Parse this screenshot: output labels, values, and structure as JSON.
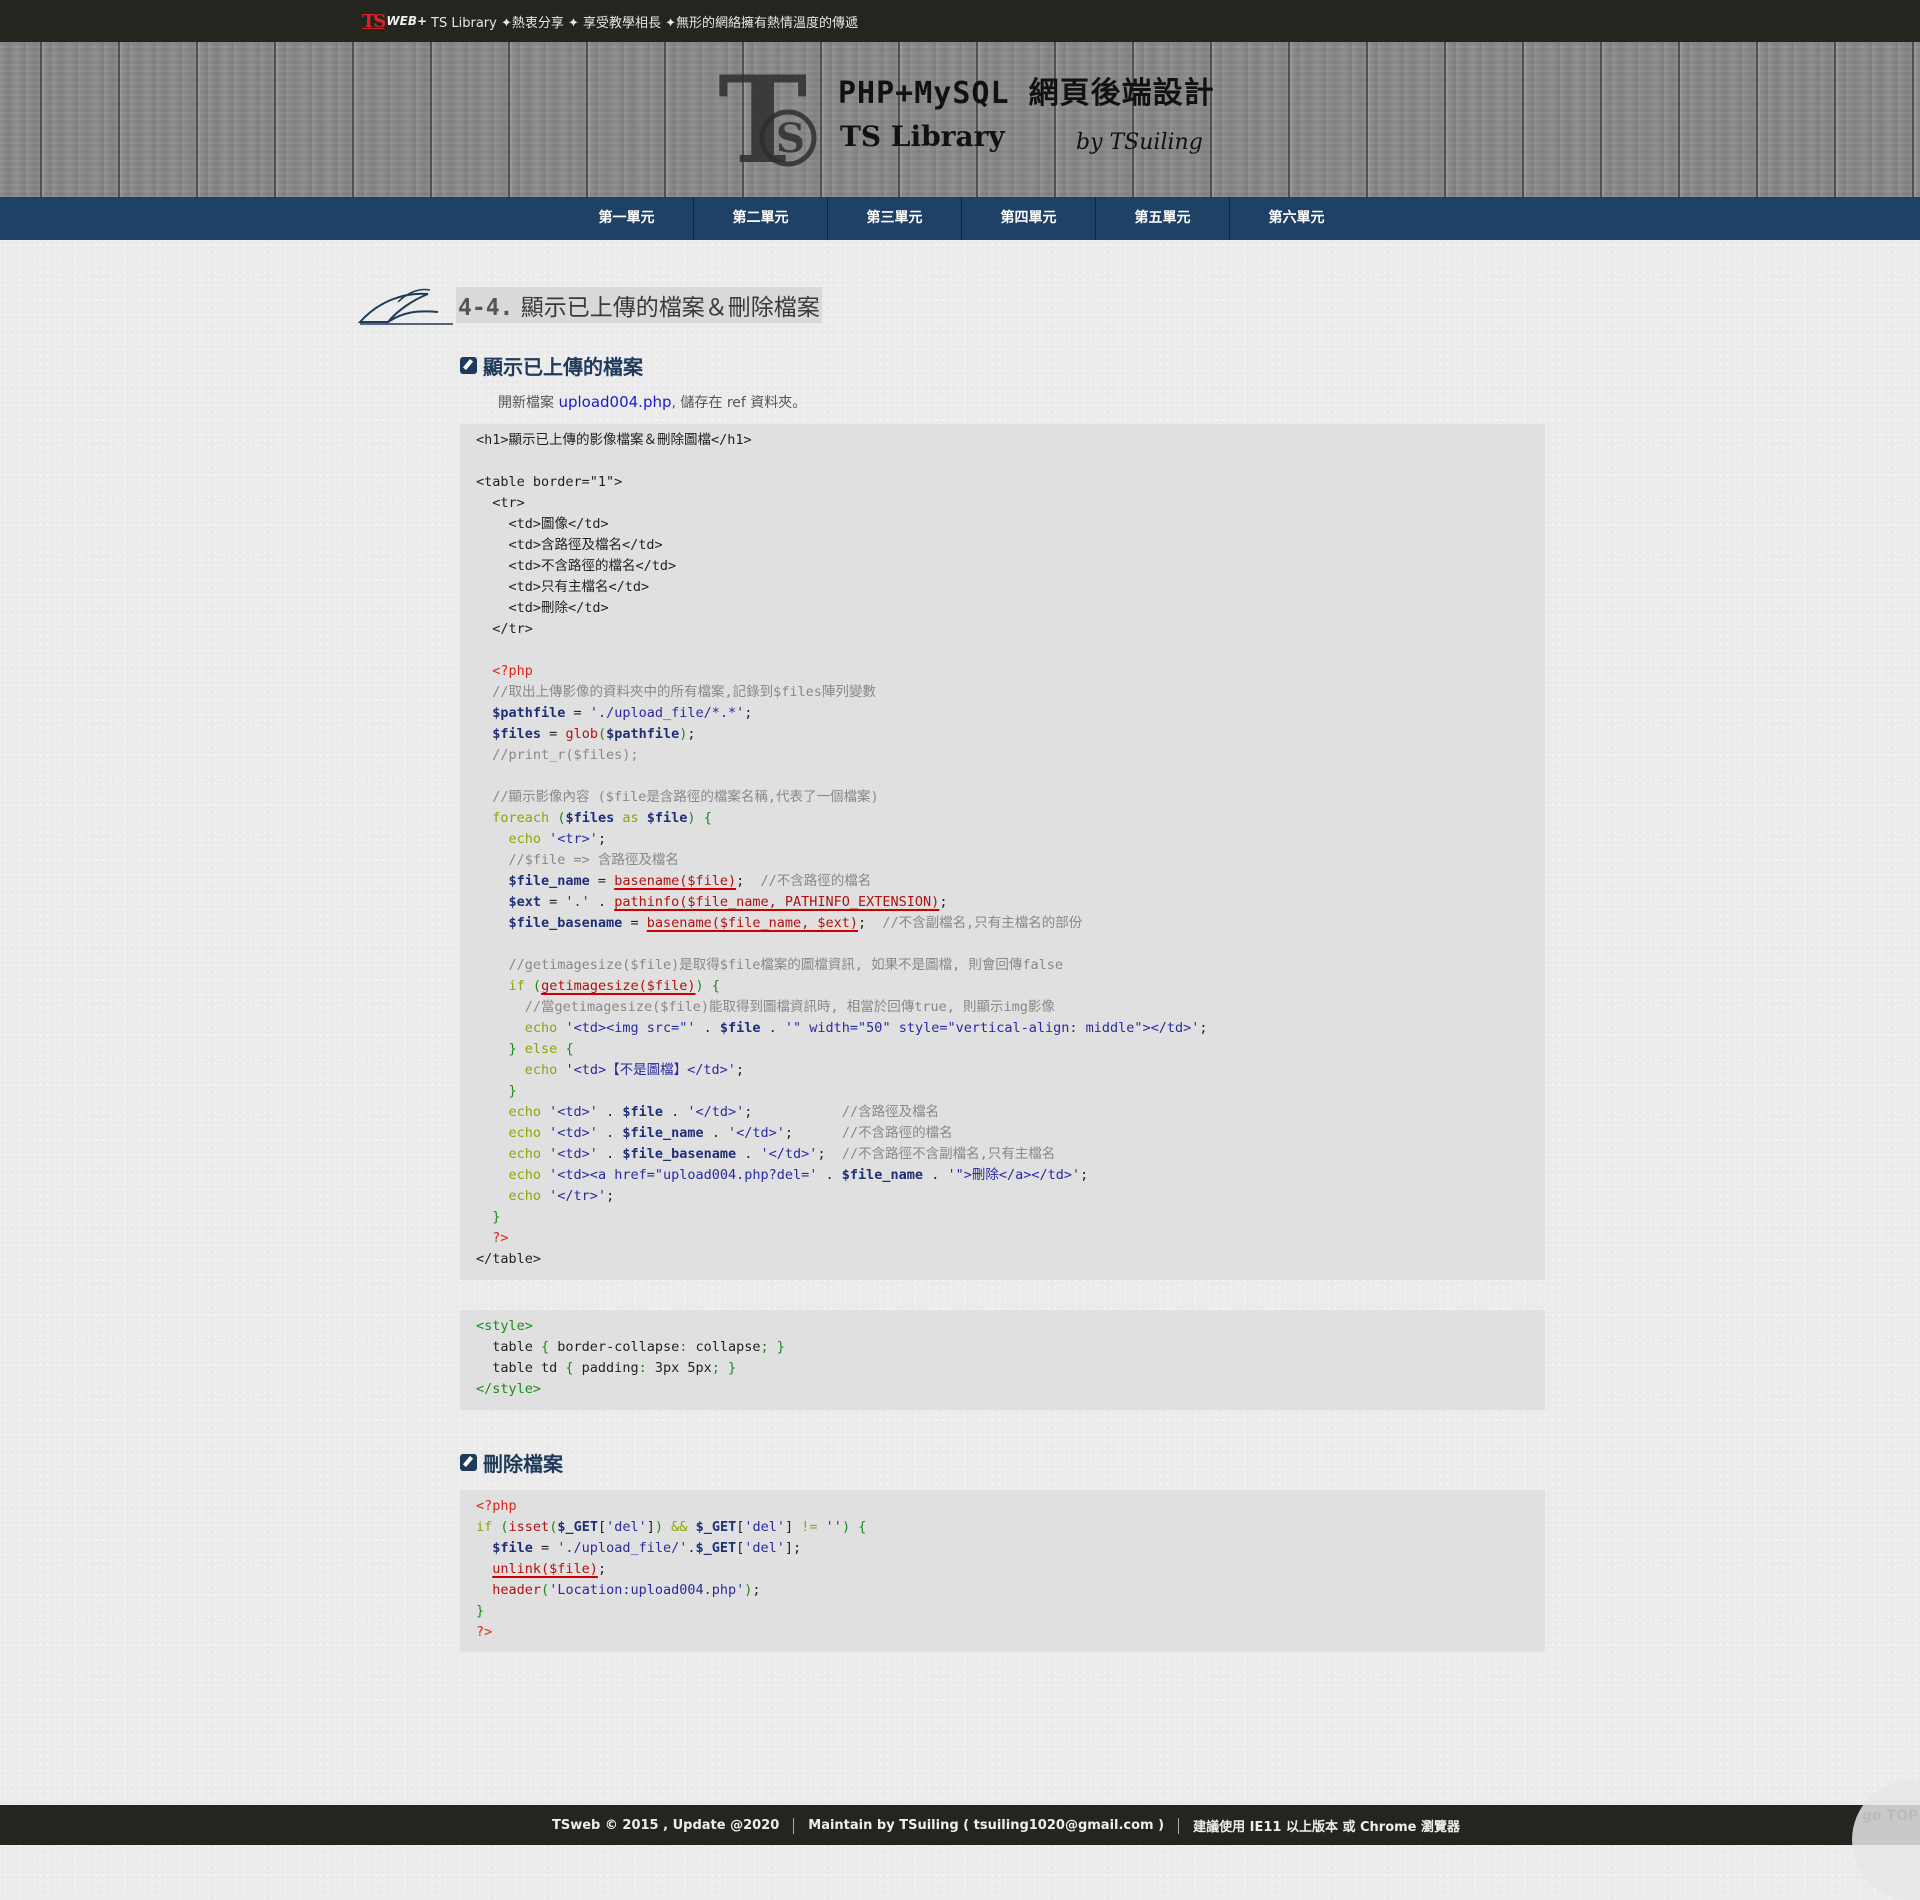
{
  "topbar": {
    "logo_ts": "TS",
    "logo_web": "WEB+",
    "tagline": "TS Library ✦熱衷分享 ✦ 享受教學相長 ✦無形的網絡擁有熱情溫度的傳遞"
  },
  "banner": {
    "title": "PHP+MySQL 網頁後端設計",
    "subtitle": "TS Library",
    "by": "by TSuiling"
  },
  "nav": {
    "items": [
      "第一單元",
      "第二單元",
      "第三單元",
      "第四單元",
      "第五單元",
      "第六單元"
    ]
  },
  "page": {
    "title_num": "4-4.",
    "title_text": "顯示已上傳的檔案＆刪除檔案",
    "section1": "顯示已上傳的檔案",
    "intro_prefix": "開新檔案",
    "intro_file": "upload004.php",
    "intro_suffix": ", 儲存在 ref 資料夾。",
    "section2": "刪除檔案"
  },
  "footer": {
    "copyright": "TSweb © 2015 , Update @2020",
    "maintain": "Maintain by TSuiling ( tsuiling1020@gmail.com )",
    "advice": "建議使用 IE11 以上版本 或 Chrome 瀏覽器",
    "gotop": "go TOP"
  },
  "code1": [
    [
      [
        "t",
        "<h1>顯示已上傳的影像檔案＆刪除圖檔</h1>"
      ]
    ],
    [],
    [
      [
        "t",
        "<table border=\"1\">"
      ]
    ],
    [
      [
        "t",
        "  <tr>"
      ]
    ],
    [
      [
        "t",
        "    <td>圖像</td>"
      ]
    ],
    [
      [
        "t",
        "    <td>含路徑及檔名</td>"
      ]
    ],
    [
      [
        "t",
        "    <td>不含路徑的檔名</td>"
      ]
    ],
    [
      [
        "t",
        "    <td>只有主檔名</td>"
      ]
    ],
    [
      [
        "t",
        "    <td>刪除</td>"
      ]
    ],
    [
      [
        "t",
        "  </tr>"
      ]
    ],
    [],
    [
      [
        "t",
        "  "
      ],
      [
        "php",
        "<?php"
      ]
    ],
    [
      [
        "t",
        "  "
      ],
      [
        "cm",
        "//取出上傳影像的資料夾中的所有檔案,記錄到$files陣列變數"
      ]
    ],
    [
      [
        "t",
        "  "
      ],
      [
        "var",
        "$pathfile"
      ],
      [
        "t",
        " = "
      ],
      [
        "str",
        "'./upload_file/*.*'"
      ],
      [
        "t",
        ";"
      ]
    ],
    [
      [
        "t",
        "  "
      ],
      [
        "var",
        "$files"
      ],
      [
        "t",
        " = "
      ],
      [
        "fnp",
        "glob"
      ],
      [
        "pn",
        "("
      ],
      [
        "var",
        "$pathfile"
      ],
      [
        "pn",
        ")"
      ],
      [
        "t",
        ";"
      ]
    ],
    [
      [
        "t",
        "  "
      ],
      [
        "cm",
        "//print_r($files);"
      ]
    ],
    [],
    [
      [
        "t",
        "  "
      ],
      [
        "cm",
        "//顯示影像內容 ($file是含路徑的檔案名稱,代表了一個檔案)"
      ]
    ],
    [
      [
        "t",
        "  "
      ],
      [
        "kw",
        "foreach"
      ],
      [
        "t",
        " "
      ],
      [
        "pn",
        "("
      ],
      [
        "var",
        "$files"
      ],
      [
        "t",
        " "
      ],
      [
        "kw",
        "as"
      ],
      [
        "t",
        " "
      ],
      [
        "var",
        "$file"
      ],
      [
        "pn",
        ")"
      ],
      [
        "t",
        " "
      ],
      [
        "pn",
        "{"
      ]
    ],
    [
      [
        "t",
        "    "
      ],
      [
        "kw",
        "echo"
      ],
      [
        "t",
        " "
      ],
      [
        "str",
        "'<tr>'"
      ],
      [
        "t",
        ";"
      ]
    ],
    [
      [
        "t",
        "    "
      ],
      [
        "cm",
        "//$file => 含路徑及檔名"
      ]
    ],
    [
      [
        "t",
        "    "
      ],
      [
        "var",
        "$file_name"
      ],
      [
        "t",
        " = "
      ],
      [
        "fn",
        "basename($file)"
      ],
      [
        "t",
        ";  "
      ],
      [
        "cm",
        "//不含路徑的檔名"
      ]
    ],
    [
      [
        "t",
        "    "
      ],
      [
        "var",
        "$ext"
      ],
      [
        "t",
        " = "
      ],
      [
        "str",
        "'.'"
      ],
      [
        "t",
        " . "
      ],
      [
        "fn",
        "pathinfo($file_name, PATHINFO_EXTENSION)"
      ],
      [
        "t",
        ";"
      ]
    ],
    [
      [
        "t",
        "    "
      ],
      [
        "var",
        "$file_basename"
      ],
      [
        "t",
        " = "
      ],
      [
        "fn",
        "basename($file_name, $ext)"
      ],
      [
        "t",
        ";  "
      ],
      [
        "cm",
        "//不含副檔名,只有主檔名的部份"
      ]
    ],
    [],
    [
      [
        "t",
        "    "
      ],
      [
        "cm",
        "//getimagesize($file)是取得$file檔案的圖檔資訊, 如果不是圖檔, 則會回傳false"
      ]
    ],
    [
      [
        "t",
        "    "
      ],
      [
        "kw",
        "if"
      ],
      [
        "t",
        " "
      ],
      [
        "pn",
        "("
      ],
      [
        "fn",
        "getimagesize($file)"
      ],
      [
        "pn",
        ")"
      ],
      [
        "t",
        " "
      ],
      [
        "pn",
        "{"
      ]
    ],
    [
      [
        "t",
        "      "
      ],
      [
        "cm",
        "//當getimagesize($file)能取得到圖檔資訊時, 相當於回傳true, 則顯示img影像"
      ]
    ],
    [
      [
        "t",
        "      "
      ],
      [
        "kw",
        "echo"
      ],
      [
        "t",
        " "
      ],
      [
        "str",
        "'<td><img src=\"'"
      ],
      [
        "t",
        " . "
      ],
      [
        "var",
        "$file"
      ],
      [
        "t",
        " . "
      ],
      [
        "str",
        "'\" width=\"50\" style=\"vertical-align: middle\"></td>'"
      ],
      [
        "t",
        ";"
      ]
    ],
    [
      [
        "t",
        "    "
      ],
      [
        "pn",
        "}"
      ],
      [
        "t",
        " "
      ],
      [
        "kw",
        "else"
      ],
      [
        "t",
        " "
      ],
      [
        "pn",
        "{"
      ]
    ],
    [
      [
        "t",
        "      "
      ],
      [
        "kw",
        "echo"
      ],
      [
        "t",
        " "
      ],
      [
        "str",
        "'<td>【不是圖檔】</td>'"
      ],
      [
        "t",
        ";"
      ]
    ],
    [
      [
        "t",
        "    "
      ],
      [
        "pn",
        "}"
      ]
    ],
    [
      [
        "t",
        "    "
      ],
      [
        "kw",
        "echo"
      ],
      [
        "t",
        " "
      ],
      [
        "str",
        "'<td>'"
      ],
      [
        "t",
        " . "
      ],
      [
        "var",
        "$file"
      ],
      [
        "t",
        " . "
      ],
      [
        "str",
        "'</td>'"
      ],
      [
        "t",
        ";           "
      ],
      [
        "cm",
        "//含路徑及檔名"
      ]
    ],
    [
      [
        "t",
        "    "
      ],
      [
        "kw",
        "echo"
      ],
      [
        "t",
        " "
      ],
      [
        "str",
        "'<td>'"
      ],
      [
        "t",
        " . "
      ],
      [
        "var",
        "$file_name"
      ],
      [
        "t",
        " . "
      ],
      [
        "str",
        "'</td>'"
      ],
      [
        "t",
        ";      "
      ],
      [
        "cm",
        "//不含路徑的檔名"
      ]
    ],
    [
      [
        "t",
        "    "
      ],
      [
        "kw",
        "echo"
      ],
      [
        "t",
        " "
      ],
      [
        "str",
        "'<td>'"
      ],
      [
        "t",
        " . "
      ],
      [
        "var",
        "$file_basename"
      ],
      [
        "t",
        " . "
      ],
      [
        "str",
        "'</td>'"
      ],
      [
        "t",
        ";  "
      ],
      [
        "cm",
        "//不含路徑不含副檔名,只有主檔名"
      ]
    ],
    [
      [
        "t",
        "    "
      ],
      [
        "kw",
        "echo"
      ],
      [
        "t",
        " "
      ],
      [
        "str",
        "'<td><a href=\"upload004.php?del='"
      ],
      [
        "t",
        " . "
      ],
      [
        "var",
        "$file_name"
      ],
      [
        "t",
        " . "
      ],
      [
        "str",
        "'\">刪除</a></td>'"
      ],
      [
        "t",
        ";"
      ]
    ],
    [
      [
        "t",
        "    "
      ],
      [
        "kw",
        "echo"
      ],
      [
        "t",
        " "
      ],
      [
        "str",
        "'</tr>'"
      ],
      [
        "t",
        ";"
      ]
    ],
    [
      [
        "t",
        "  "
      ],
      [
        "pn",
        "}"
      ]
    ],
    [
      [
        "t",
        "  "
      ],
      [
        "php",
        "?>"
      ]
    ],
    [
      [
        "t",
        "</table>"
      ]
    ]
  ],
  "code2": [
    [
      [
        "pn",
        "<style>"
      ]
    ],
    [
      [
        "t",
        "  table "
      ],
      [
        "pn",
        "{"
      ],
      [
        "t",
        " border-collapse"
      ],
      [
        "pn",
        ":"
      ],
      [
        "t",
        " collapse"
      ],
      [
        "pn",
        ";"
      ],
      [
        "t",
        " "
      ],
      [
        "pn",
        "}"
      ]
    ],
    [
      [
        "t",
        "  table td "
      ],
      [
        "pn",
        "{"
      ],
      [
        "t",
        " padding"
      ],
      [
        "pn",
        ":"
      ],
      [
        "t",
        " 3px 5px"
      ],
      [
        "pn",
        ";"
      ],
      [
        "t",
        " "
      ],
      [
        "pn",
        "}"
      ]
    ],
    [
      [
        "pn",
        "</style>"
      ]
    ]
  ],
  "code3": [
    [
      [
        "php",
        "<?php"
      ]
    ],
    [
      [
        "kw",
        "if"
      ],
      [
        "t",
        " "
      ],
      [
        "pn",
        "("
      ],
      [
        "fnp",
        "isset"
      ],
      [
        "pn",
        "("
      ],
      [
        "var",
        "$_GET"
      ],
      [
        "t",
        "["
      ],
      [
        "str",
        "'del'"
      ],
      [
        "t",
        "]"
      ],
      [
        "pn",
        ")"
      ],
      [
        "t",
        " "
      ],
      [
        "kw",
        "&&"
      ],
      [
        "t",
        " "
      ],
      [
        "var",
        "$_GET"
      ],
      [
        "t",
        "["
      ],
      [
        "str",
        "'del'"
      ],
      [
        "t",
        "] "
      ],
      [
        "kw",
        "!="
      ],
      [
        "t",
        " "
      ],
      [
        "str",
        "''"
      ],
      [
        "pn",
        ")"
      ],
      [
        "t",
        " "
      ],
      [
        "pn",
        "{"
      ]
    ],
    [
      [
        "t",
        "  "
      ],
      [
        "var",
        "$file"
      ],
      [
        "t",
        " = "
      ],
      [
        "str",
        "'./upload_file/'"
      ],
      [
        "t",
        "."
      ],
      [
        "var",
        "$_GET"
      ],
      [
        "t",
        "["
      ],
      [
        "str",
        "'del'"
      ],
      [
        "t",
        "];"
      ]
    ],
    [
      [
        "t",
        "  "
      ],
      [
        "fn",
        "unlink($file)"
      ],
      [
        "t",
        ";"
      ]
    ],
    [
      [
        "t",
        "  "
      ],
      [
        "fnp",
        "header"
      ],
      [
        "pn",
        "("
      ],
      [
        "str",
        "'Location:upload004.php'"
      ],
      [
        "pn",
        ")"
      ],
      [
        "t",
        ";"
      ]
    ],
    [
      [
        "pn",
        "}"
      ]
    ],
    [
      [
        "php",
        "?>"
      ]
    ]
  ]
}
